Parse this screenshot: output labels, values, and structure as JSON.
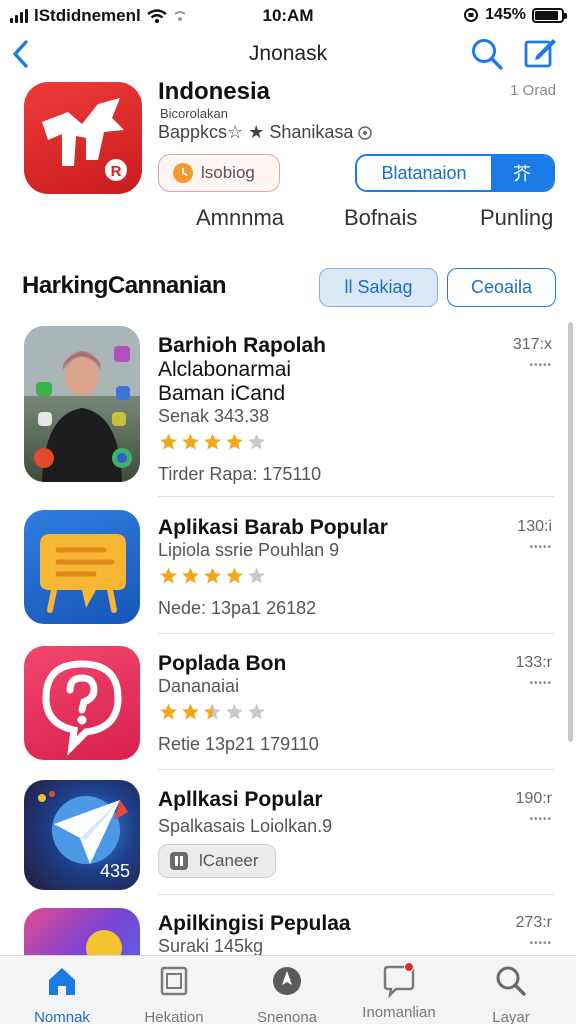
{
  "status_bar": {
    "carrier": "lStdidnemenl",
    "time": "10:AM",
    "battery_text": "145%",
    "battery_level": 0.9
  },
  "nav": {
    "title": "Jnonask"
  },
  "featured": {
    "name": "Indonesia",
    "subtitle": "Bicorolakan",
    "meta": "Bappkcs☆ ★ Shanikasa",
    "count": "1 Orad",
    "chip_label": "lsobiog",
    "segment_left": "Blatanaion",
    "segment_right": "芥",
    "tabs": [
      "Amnnma",
      "Bofnais",
      "Punling"
    ]
  },
  "section": {
    "title": "HarkingCannanian",
    "btn_primary": "ll Sakiag",
    "btn_secondary": "Ceoaila"
  },
  "apps": [
    {
      "title_lines": [
        "Barhioh Rapolah",
        "Alclabonarmai",
        "Baman iCand"
      ],
      "line1": "Senak 343.38",
      "rating": 4,
      "line2": "Tirder Rapa: 175110",
      "price": "317:x",
      "icon": "portrait-app-icon"
    },
    {
      "title_lines": [
        "Aplikasi Barab Popular"
      ],
      "line1": "Lipiola ssrie Pouhlan 9",
      "rating": 4,
      "line2": "Nede: 13pa1 26182",
      "price": "130:i",
      "icon": "chat-board-icon"
    },
    {
      "title_lines": [
        "Poplada Bon"
      ],
      "line1": "Dananaiai",
      "rating": 2.5,
      "line2": "Retie 13p21 179110",
      "price": "133:r",
      "icon": "question-bubble-icon"
    },
    {
      "title_lines": [
        "Apllkasi Popular"
      ],
      "line1": "Spalkasais Loiolkan.9",
      "pill": "lCaneer",
      "price": "190:r",
      "icon_badge": "435",
      "icon": "paper-plane-icon"
    },
    {
      "title_lines": [
        "Apilkingisi Pepulaa"
      ],
      "line1": "Suraki 145kg",
      "price": "273:r",
      "icon": "gradient-app-icon"
    }
  ],
  "tabbar": {
    "items": [
      {
        "label": "Nomnak",
        "icon": "home-icon",
        "active": true
      },
      {
        "label": "Hekation",
        "icon": "frame-icon",
        "active": false
      },
      {
        "label": "Snenona",
        "icon": "compass-icon",
        "active": false
      },
      {
        "label": "Inomanlian",
        "icon": "message-icon",
        "active": false
      },
      {
        "label": "Layar",
        "icon": "search-icon",
        "active": false
      }
    ]
  },
  "colors": {
    "accent": "#1a7be6",
    "star": "#f2a81d",
    "hero_red": "#e12f2f"
  }
}
